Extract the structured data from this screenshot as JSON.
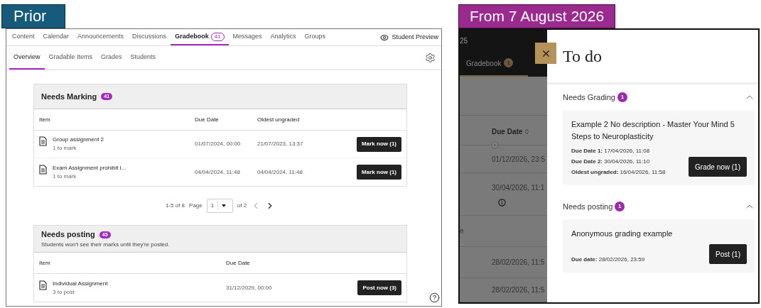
{
  "prior": {
    "label": "Prior",
    "nav_tabs": [
      {
        "label": "Content",
        "selected": false
      },
      {
        "label": "Calendar",
        "selected": false
      },
      {
        "label": "Announcements",
        "selected": false
      },
      {
        "label": "Discussions",
        "selected": false
      },
      {
        "label": "Gradebook",
        "badge": "41",
        "selected": true
      },
      {
        "label": "Messages",
        "selected": false
      },
      {
        "label": "Analytics",
        "selected": false
      },
      {
        "label": "Groups",
        "selected": false
      }
    ],
    "student_preview": "Student Preview",
    "sub_tabs": [
      {
        "label": "Overview",
        "selected": true
      },
      {
        "label": "Gradable Items",
        "selected": false
      },
      {
        "label": "Grades",
        "selected": false
      },
      {
        "label": "Students",
        "selected": false
      }
    ],
    "needs_marking": {
      "title": "Needs Marking",
      "count": "41",
      "columns": [
        "Item",
        "Due Date",
        "Oldest ungraded"
      ],
      "rows": [
        {
          "item": "Group assignment 2",
          "sub": "1 to mark",
          "due": "01/07/2024, 00:00",
          "oldest": "21/07/2023, 13:37",
          "action": "Mark now (1)"
        },
        {
          "item": "Exam Assignment prohibit l...",
          "sub": "1 to mark",
          "due": "04/04/2024, 11:48",
          "oldest": "04/04/2024, 11:48",
          "action": "Mark now (1)"
        }
      ]
    },
    "pagination": {
      "range": "1-5 of 8",
      "page_label": "Page",
      "page": "1",
      "of": "of 2"
    },
    "needs_posting": {
      "title": "Needs posting",
      "count": "45",
      "note": "Students won't see their marks until they're posted.",
      "columns": [
        "Item",
        "Due Date"
      ],
      "rows": [
        {
          "item": "Individual Assignment",
          "sub": "3 to post",
          "due": "31/12/2029, 00:00",
          "action": "Post now (3)"
        }
      ]
    }
  },
  "new": {
    "label": "From 7 August 2026",
    "background": {
      "header": "25",
      "tab": {
        "label": "Gradebook",
        "badge": "1"
      },
      "column": "Due Date",
      "cells": [
        {
          "kind": "date",
          "text": "01/12/2026, 23:5"
        },
        {
          "kind": "date",
          "text": "30/04/2026, 11:1",
          "info": true
        },
        {
          "kind": "fragment",
          "text": "e"
        },
        {
          "kind": "date",
          "text": "28/02/2026, 11:5"
        },
        {
          "kind": "date",
          "text": "28/02/2026, 11:5"
        }
      ]
    },
    "drawer": {
      "title": "To do",
      "sections": [
        {
          "title": "Needs Grading",
          "count": "1",
          "expanded": true,
          "items": [
            {
              "title": "Example 2 No description - Master Your Mind 5 Steps to Neuroplasticity",
              "details": [
                "**Due Date 1:** 17/04/2026, 11:08",
                "**Due Date 2:** 30/04/2026, 11:10",
                "**Oldest ungraded:** 16/04/2026, 11:58"
              ],
              "action": "Grade now (1)"
            }
          ]
        },
        {
          "title": "Needs posting",
          "count": "1",
          "expanded": true,
          "items": [
            {
              "title": "Anonymous grading example",
              "details": [
                "**Due date:** 28/02/2026, 23:59"
              ],
              "action": "Post (1)"
            }
          ]
        }
      ]
    }
  }
}
